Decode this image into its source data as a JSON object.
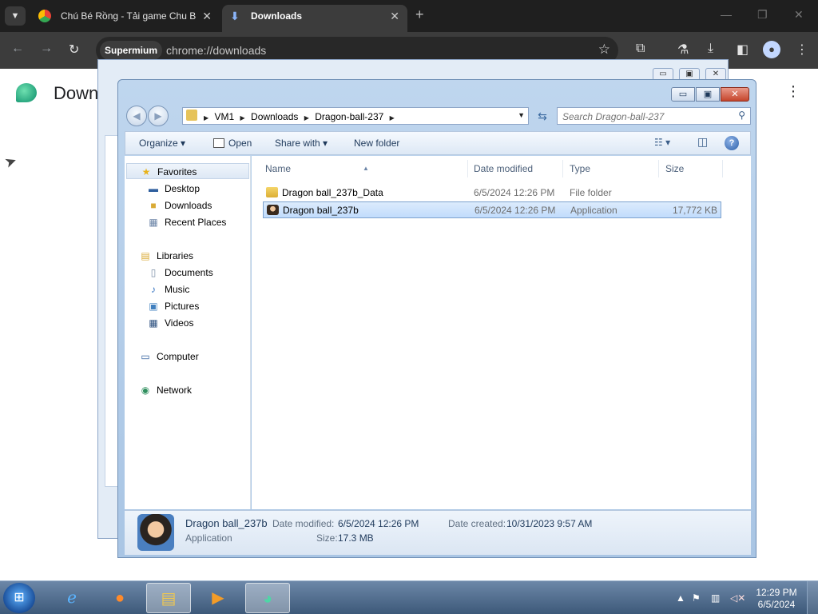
{
  "chrome": {
    "tabs": [
      {
        "label": "Chú Bé Rồng - Tải game Chu B",
        "close": "✕"
      },
      {
        "label": "Downloads",
        "close": "✕"
      }
    ],
    "new_tab": "+",
    "window_controls": {
      "minimize": "—",
      "maximize": "❐",
      "close": "✕"
    },
    "omnibox": {
      "chip": "Supermium",
      "url": "chrome://downloads"
    },
    "page": {
      "title": "Down",
      "menu": "⋮"
    }
  },
  "explorer": {
    "caption": {
      "minimize": "▭",
      "maximize": "▣",
      "close": "✕"
    },
    "breadcrumb": [
      "VM1",
      "Downloads",
      "Dragon-ball-237"
    ],
    "search_placeholder": "Search Dragon-ball-237",
    "commands": {
      "organize": "Organize ▾",
      "open": "Open",
      "share_with": "Share with ▾",
      "new_folder": "New folder"
    },
    "nav": {
      "favorites": "Favorites",
      "desktop": "Desktop",
      "downloads": "Downloads",
      "recent_places": "Recent Places",
      "libraries": "Libraries",
      "documents": "Documents",
      "music": "Music",
      "pictures": "Pictures",
      "videos": "Videos",
      "computer": "Computer",
      "network": "Network"
    },
    "columns": {
      "name": "Name",
      "date_modified": "Date modified",
      "type": "Type",
      "size": "Size"
    },
    "files": [
      {
        "name": "Dragon ball_237b_Data",
        "date": "6/5/2024 12:26 PM",
        "type": "File folder",
        "size": ""
      },
      {
        "name": "Dragon ball_237b",
        "date": "6/5/2024 12:26 PM",
        "type": "Application",
        "size": "17,772 KB"
      }
    ],
    "details": {
      "name": "Dragon ball_237b",
      "type": "Application",
      "date_modified_label": "Date modified:",
      "date_modified": "6/5/2024 12:26 PM",
      "date_created_label": "Date created:",
      "date_created": "10/31/2023 9:57 AM",
      "size_label": "Size:",
      "size": "17.3 MB"
    }
  },
  "taskbar": {
    "clock_time": "12:29 PM",
    "clock_date": "6/5/2024"
  },
  "colors": {
    "chrome_dark": "#1f1f1f",
    "explorer_frame": "#bfd6ee",
    "selection": "#c1dcfc",
    "taskbar": "#3d5979"
  }
}
